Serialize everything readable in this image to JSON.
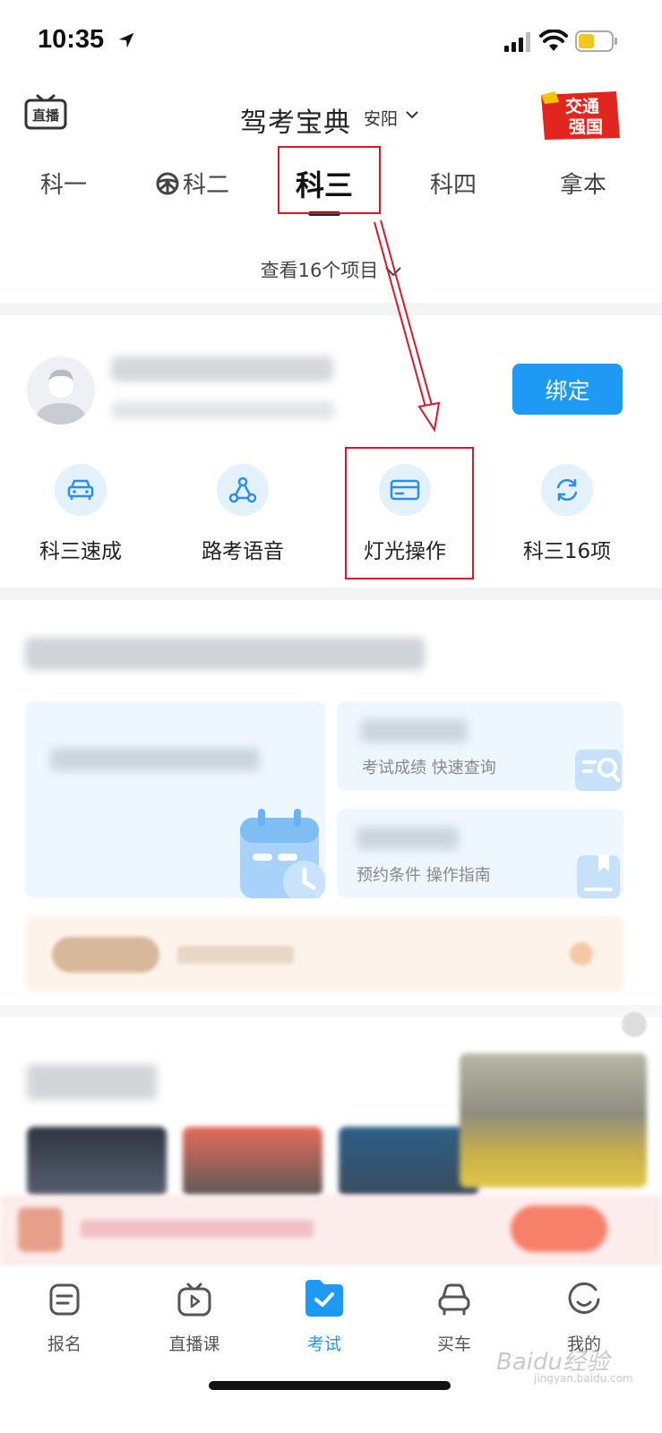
{
  "status_bar": {
    "time": "10:35"
  },
  "header": {
    "live_icon_label": "直播",
    "app_title": "驾考宝典",
    "city": "安阳",
    "promo_badge_text_1": "交通",
    "promo_badge_text_2": "强国"
  },
  "tabs": [
    {
      "label": "科一"
    },
    {
      "label": "科二"
    },
    {
      "label": "科三",
      "active": true
    },
    {
      "label": "科四"
    },
    {
      "label": "拿本"
    }
  ],
  "view_items_label": "查看16个项目",
  "profile": {
    "bind_button": "绑定"
  },
  "features": [
    {
      "label": "科三速成",
      "icon": "car-icon"
    },
    {
      "label": "路考语音",
      "icon": "route-icon"
    },
    {
      "label": "灯光操作",
      "icon": "card-icon"
    },
    {
      "label": "科三16项",
      "icon": "refresh-icon"
    }
  ],
  "cards": {
    "score_query_sub": "考试成绩 快速查询",
    "booking_sub": "预约条件 操作指南"
  },
  "bottom_nav": [
    {
      "label": "报名",
      "icon": "register-icon"
    },
    {
      "label": "直播课",
      "icon": "tv-icon"
    },
    {
      "label": "考试",
      "icon": "exam-folder-icon",
      "active": true
    },
    {
      "label": "买车",
      "icon": "car-front-icon"
    },
    {
      "label": "我的",
      "icon": "smile-icon"
    }
  ],
  "watermark": {
    "text": "Baidu经验",
    "sub": "jingyan.baidu.com"
  },
  "colors": {
    "accent": "#1e9af5",
    "annotation_red": "#d61a2c",
    "card_bg": "#eef6fe"
  }
}
